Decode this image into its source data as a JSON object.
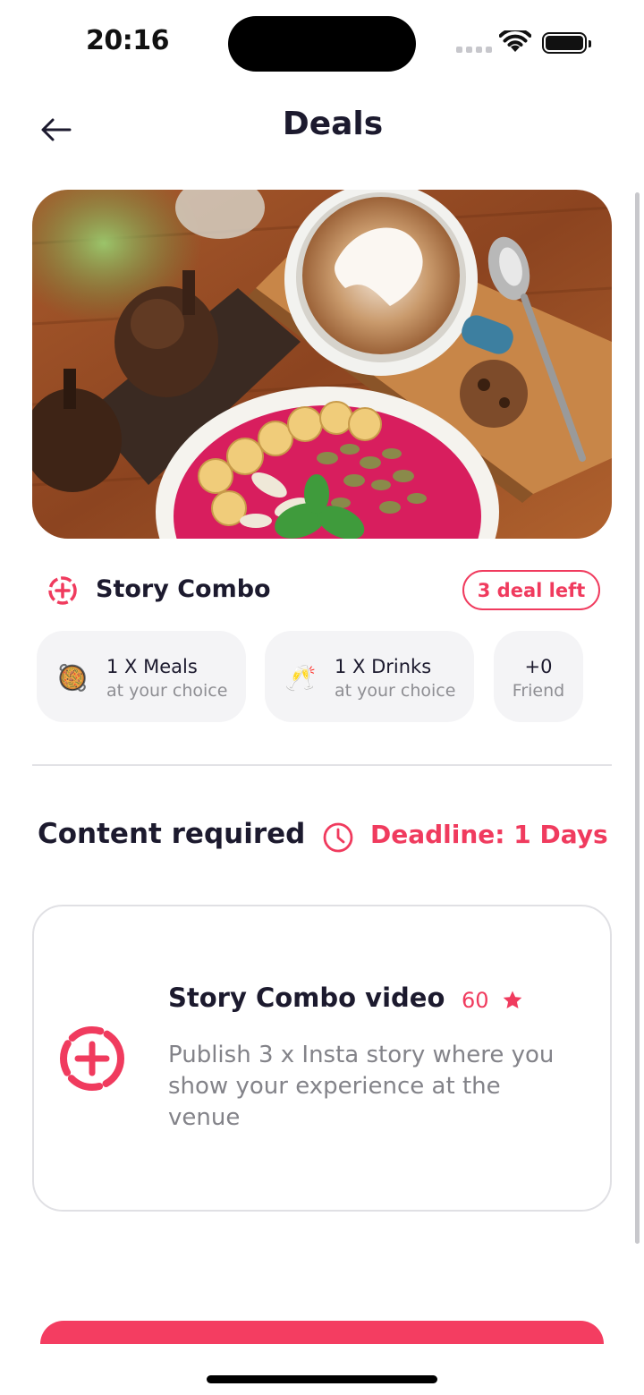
{
  "status_bar": {
    "time": "20:16"
  },
  "header": {
    "title": "Deals",
    "back_icon": "arrow-left-icon"
  },
  "hero": {
    "alt": "Latte art coffee and smoothie bowl on wooden table"
  },
  "deal": {
    "name": "Story Combo",
    "badge": "3 deal left",
    "icon": "story-plus-icon",
    "accent": "#f03b5e"
  },
  "chips": [
    {
      "emoji": "🥘",
      "title": "1 X Meals",
      "subtitle": "at your choice"
    },
    {
      "emoji": "🥂",
      "title": "1 X Drinks",
      "subtitle": "at your choice"
    },
    {
      "title": "+0",
      "subtitle": "Friend"
    }
  ],
  "content": {
    "heading": "Content required",
    "deadline": "Deadline: 1 Days",
    "deadline_icon": "clock-icon"
  },
  "task": {
    "title": "Story Combo video",
    "points": "60",
    "points_icon": "star-icon",
    "description": "Publish 3 x Insta story where you show your experience at the venue"
  },
  "colors": {
    "accent": "#f03b5e",
    "button": "#f43d61",
    "text": "#1c1a2e",
    "muted": "#838389"
  }
}
